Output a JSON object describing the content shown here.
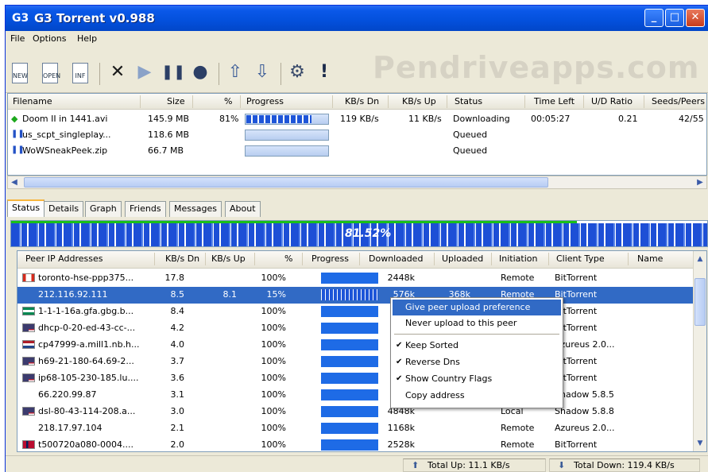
{
  "window": {
    "title": "G3 Torrent v0.988",
    "app_icon": "G3"
  },
  "titlebar_buttons": {
    "minimize": "_",
    "maximize": "□",
    "close": "✕"
  },
  "menu": [
    "File",
    "Options",
    "Help"
  ],
  "toolbar": {
    "new_label": "NEW",
    "open_label": "OPEN",
    "info_label": "INF",
    "remove": "✕",
    "start": "▶",
    "pause": "❚❚",
    "stop": "●",
    "up": "⇧",
    "down": "⇩",
    "settings": "⚙",
    "alert": "!"
  },
  "watermark": "Pendriveapps.com",
  "torrents": {
    "columns": [
      "Filename",
      "Size",
      "%",
      "Progress",
      "KB/s Dn",
      "KB/s Up",
      "Status",
      "Time Left",
      "U/D Ratio",
      "Seeds/Peers"
    ],
    "rows": [
      {
        "icon": "download-arrow-icon",
        "name": "Doom II in 1441.avi",
        "size": "145.9 MB",
        "percent": "81%",
        "progress": 0.81,
        "dn": "119 KB/s",
        "up": "11 KB/s",
        "status": "Downloading",
        "time_left": "00:05:27",
        "ratio": "0.21",
        "seeds": "42/55"
      },
      {
        "icon": "pause-icon",
        "name": "us_scpt_singleplay...",
        "size": "118.6 MB",
        "percent": "",
        "progress": 0,
        "dn": "",
        "up": "",
        "status": "Queued",
        "time_left": "",
        "ratio": "",
        "seeds": ""
      },
      {
        "icon": "pause-icon",
        "name": "WoWSneakPeek.zip",
        "size": "66.7 MB",
        "percent": "",
        "progress": 0,
        "dn": "",
        "up": "",
        "status": "Queued",
        "time_left": "",
        "ratio": "",
        "seeds": ""
      }
    ]
  },
  "tabs": [
    "Status",
    "Details",
    "Graph",
    "Friends",
    "Messages",
    "About"
  ],
  "overall_progress": {
    "label": "81.52%",
    "value": 0.8152
  },
  "peers": {
    "columns": [
      "Peer IP Addresses",
      "KB/s Dn",
      "KB/s Up",
      "%",
      "Progress",
      "Downloaded",
      "Uploaded",
      "Initiation",
      "Client Type",
      "Name"
    ],
    "rows": [
      {
        "flag": "canada",
        "ip": "toronto-hse-ppp375...",
        "dn": "17.8",
        "up": "",
        "pct": "100%",
        "downloaded": "2448k",
        "uploaded": "",
        "init": "Remote",
        "client": "BitTorrent"
      },
      {
        "flag": "",
        "ip": "212.116.92.111",
        "dn": "8.5",
        "up": "8.1",
        "pct": "15%",
        "downloaded": "576k",
        "uploaded": "368k",
        "init": "Remote",
        "client": "BitTorrent"
      },
      {
        "flag": "nigeria",
        "ip": "1-1-1-16a.gfa.gbg.b...",
        "dn": "8.4",
        "up": "",
        "pct": "100%",
        "downloaded": "",
        "uploaded": "",
        "init": "",
        "client": "BitTorrent"
      },
      {
        "flag": "usa",
        "ip": "dhcp-0-20-ed-43-cc-...",
        "dn": "4.2",
        "up": "",
        "pct": "100%",
        "downloaded": "",
        "uploaded": "",
        "init": "",
        "client": "BitTorrent"
      },
      {
        "flag": "netherlands",
        "ip": "cp47999-a.mill1.nb.h...",
        "dn": "4.0",
        "up": "",
        "pct": "100%",
        "downloaded": "",
        "uploaded": "",
        "init": "",
        "client": "Azureus 2.0..."
      },
      {
        "flag": "usa",
        "ip": "h69-21-180-64.69-2...",
        "dn": "3.7",
        "up": "",
        "pct": "100%",
        "downloaded": "",
        "uploaded": "",
        "init": "",
        "client": "BitTorrent"
      },
      {
        "flag": "usa",
        "ip": "ip68-105-230-185.lu....",
        "dn": "3.6",
        "up": "",
        "pct": "100%",
        "downloaded": "",
        "uploaded": "",
        "init": "",
        "client": "BitTorrent"
      },
      {
        "flag": "",
        "ip": "66.220.99.87",
        "dn": "3.1",
        "up": "",
        "pct": "100%",
        "downloaded": "",
        "uploaded": "",
        "init": "",
        "client": "Shadow 5.8.5"
      },
      {
        "flag": "usa",
        "ip": "dsl-80-43-114-208.a...",
        "dn": "3.0",
        "up": "",
        "pct": "100%",
        "downloaded": "4848k",
        "uploaded": "",
        "init": "Local",
        "client": "Shadow 5.8.8"
      },
      {
        "flag": "",
        "ip": "218.17.97.104",
        "dn": "2.1",
        "up": "",
        "pct": "100%",
        "downloaded": "1168k",
        "uploaded": "",
        "init": "Remote",
        "client": "Azureus 2.0..."
      },
      {
        "flag": "norway",
        "ip": "t500720a080-0004....",
        "dn": "2.0",
        "up": "",
        "pct": "100%",
        "downloaded": "2528k",
        "uploaded": "",
        "init": "Remote",
        "client": "BitTorrent"
      }
    ]
  },
  "context_menu": {
    "items": [
      {
        "label": "Give peer upload preference",
        "checked": false,
        "highlighted": true
      },
      {
        "label": "Never upload to this peer",
        "checked": false,
        "highlighted": false
      },
      {
        "label": "Keep Sorted",
        "checked": true,
        "highlighted": false
      },
      {
        "label": "Reverse Dns",
        "checked": true,
        "highlighted": false
      },
      {
        "label": "Show Country Flags",
        "checked": true,
        "highlighted": false
      },
      {
        "label": "Copy address",
        "checked": false,
        "highlighted": false
      }
    ]
  },
  "status": {
    "total_up": "Total Up: 11.1 KB/s",
    "total_down": "Total Down: 119.4 KB/s"
  },
  "colors": {
    "title_blue": "#0350dc",
    "selection": "#316ac5",
    "progress_blue": "#1e55d8",
    "green_bar": "#19c019"
  }
}
